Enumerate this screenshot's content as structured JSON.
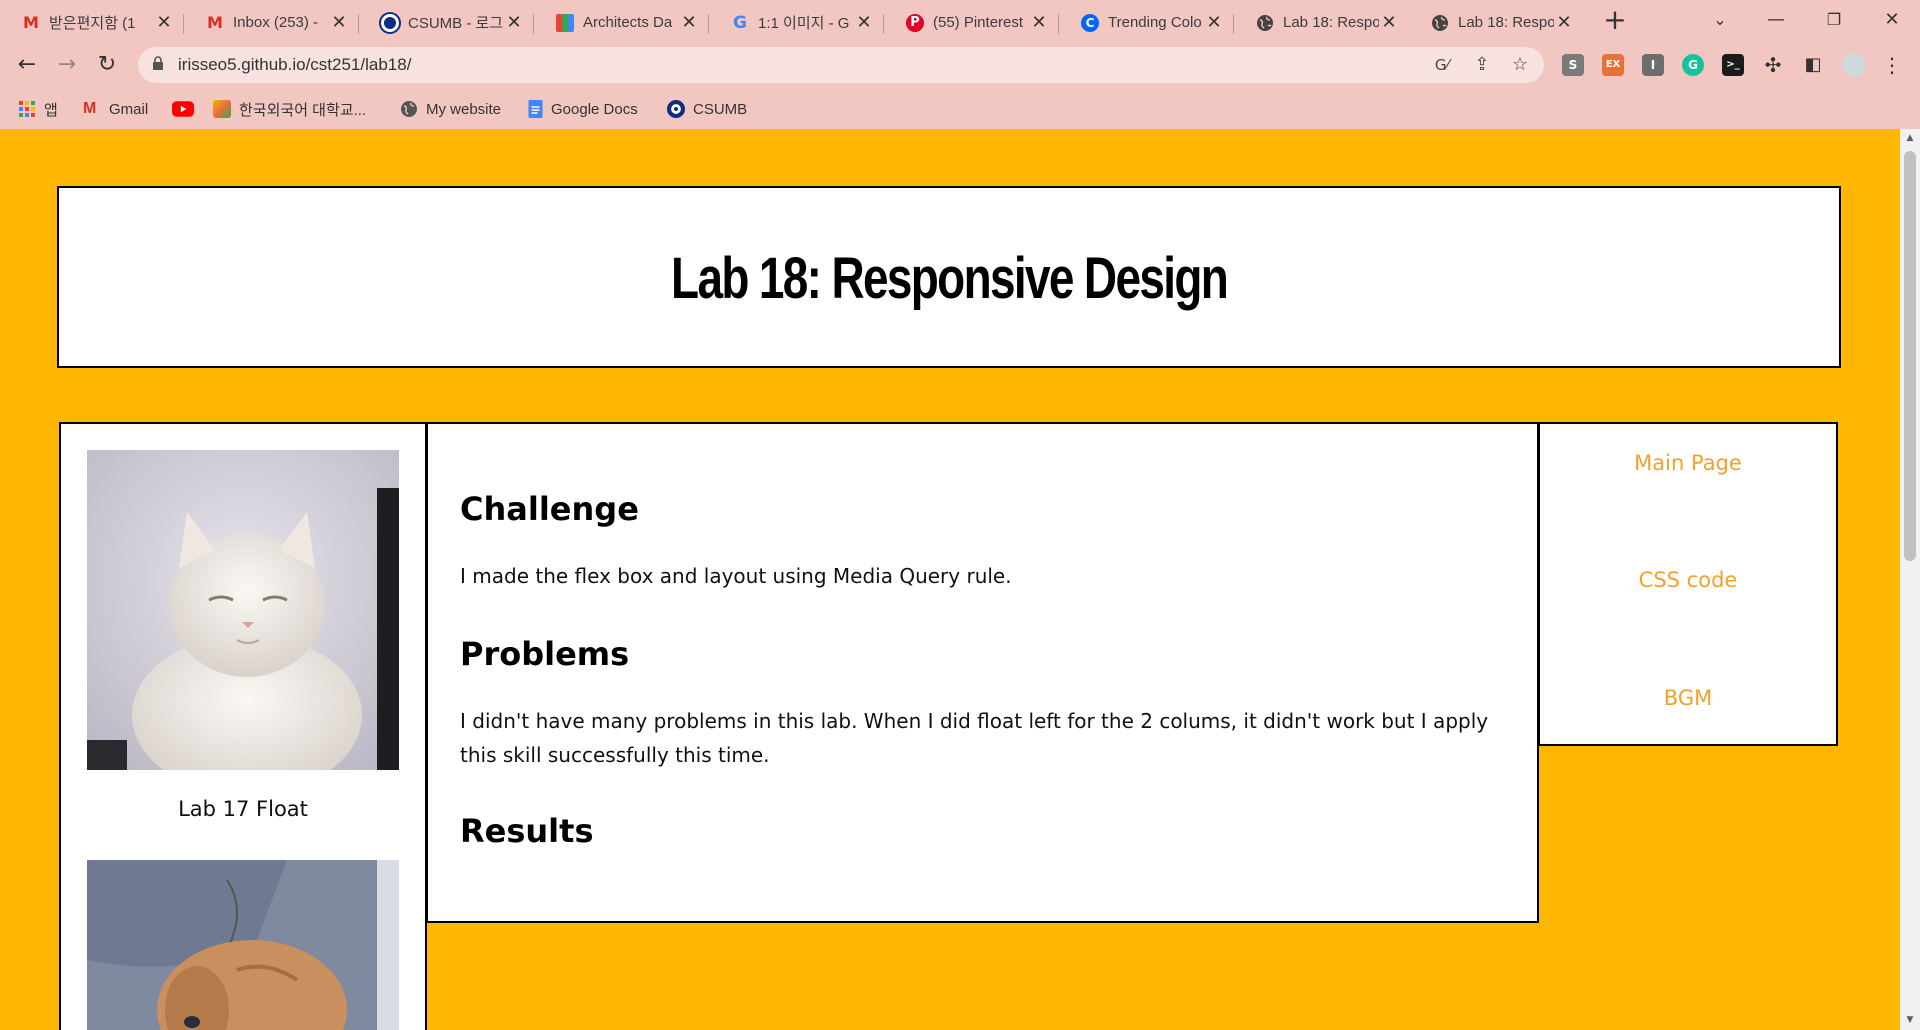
{
  "browser": {
    "tabs": [
      {
        "title": "받은편지함 (1",
        "favicon": "gmail-icon",
        "color": "#D93025"
      },
      {
        "title": "Inbox (253) -",
        "favicon": "gmail-icon",
        "color": "#D93025"
      },
      {
        "title": "CSUMB - 로그",
        "favicon": "csumb-icon",
        "color": "#0C2D83"
      },
      {
        "title": "Architects Da",
        "favicon": "architects-icon",
        "color": "#4285F4"
      },
      {
        "title": "1:1 이미지 - G",
        "favicon": "google-icon",
        "color": "#4285F4"
      },
      {
        "title": "(55) Pinterest",
        "favicon": "pinterest-icon",
        "color": "#E60023"
      },
      {
        "title": "Trending Colo",
        "favicon": "coolors-icon",
        "color": "#0066FF"
      },
      {
        "title": "Lab 18: Respo",
        "favicon": "globe-icon",
        "color": "#444444"
      },
      {
        "title": "Lab 18: Respo",
        "favicon": "globe-icon",
        "color": "#444444"
      }
    ],
    "url": "irisseo5.github.io/cst251/lab18/",
    "bookmarks": [
      {
        "label": "앱",
        "icon": "apps-grid-icon"
      },
      {
        "label": "Gmail",
        "icon": "gmail-icon"
      },
      {
        "label": "",
        "icon": "youtube-icon"
      },
      {
        "label": "한국외국어 대학교...",
        "icon": "hufs-icon"
      },
      {
        "label": "My website",
        "icon": "globe-icon"
      },
      {
        "label": "Google Docs",
        "icon": "google-docs-icon"
      },
      {
        "label": "CSUMB",
        "icon": "csumb-icon"
      }
    ],
    "extensions": [
      {
        "label": "S",
        "color": "#7a7a7a"
      },
      {
        "label": "EX",
        "color": "#E8703A"
      },
      {
        "label": "I",
        "color": "#6d6d6d"
      },
      {
        "label": "G",
        "color": "#15C39A"
      },
      {
        "label": ">_",
        "color": "#1b1b1b"
      }
    ]
  },
  "page": {
    "title": "Lab 18: Responsive Design",
    "sidebar_caption": "Lab 17 Float",
    "sections": [
      {
        "heading": "Challenge",
        "text": "I made the flex box and layout using Media Query rule."
      },
      {
        "heading": "Problems",
        "text": "I didn't have many problems in this lab. When I did float left for the 2 colums, it didn't work but I apply this skill successfully this time."
      },
      {
        "heading": "Results",
        "text": ""
      }
    ],
    "nav_links": [
      "Main Page",
      "CSS code",
      "BGM"
    ],
    "colors": {
      "background": "#FFB703",
      "link": "#F4A12B",
      "border": "#000000"
    }
  }
}
